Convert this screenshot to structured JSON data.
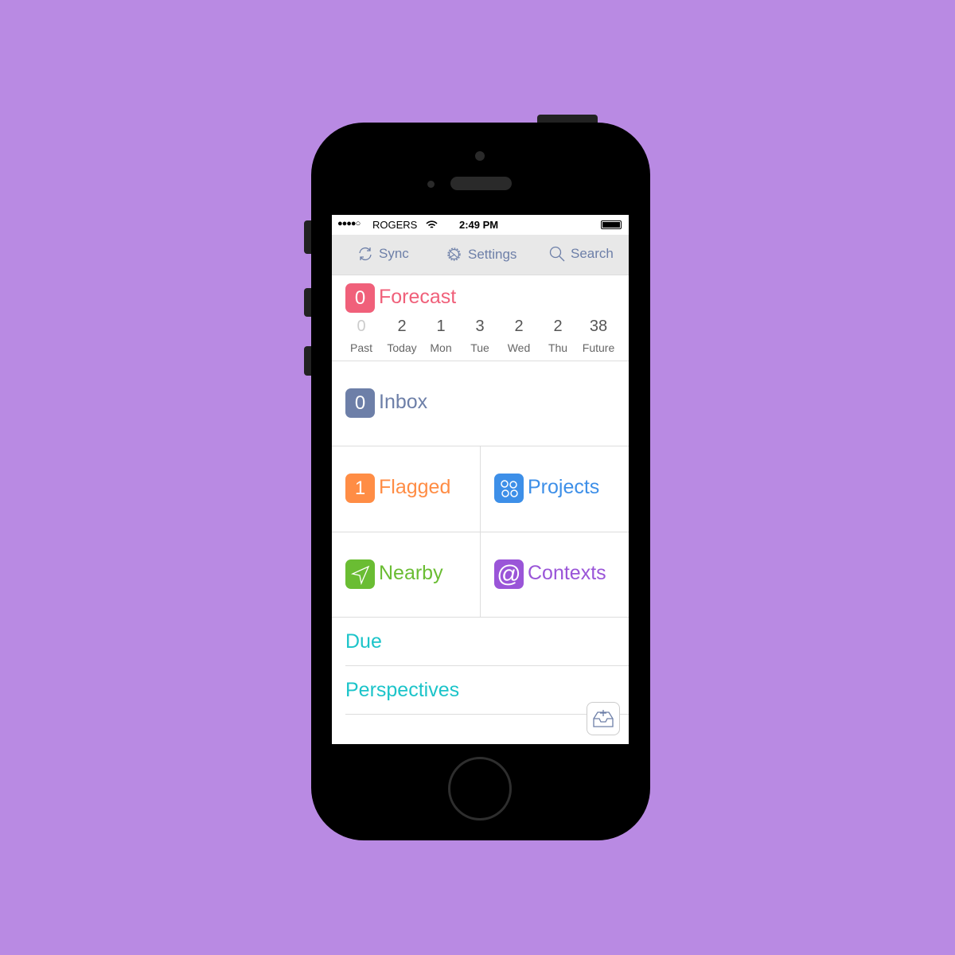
{
  "status_bar": {
    "carrier": "ROGERS",
    "signal": "●●●●○",
    "time": "2:49 PM",
    "icons": [
      "wifi-icon",
      "battery-icon"
    ]
  },
  "toolbar": {
    "sync": "Sync",
    "settings": "Settings",
    "search": "Search"
  },
  "forecast": {
    "count": "0",
    "label": "Forecast",
    "color": "#f0607a",
    "days": [
      {
        "n": "0",
        "l": "Past"
      },
      {
        "n": "2",
        "l": "Today"
      },
      {
        "n": "1",
        "l": "Mon"
      },
      {
        "n": "3",
        "l": "Tue"
      },
      {
        "n": "2",
        "l": "Wed"
      },
      {
        "n": "2",
        "l": "Thu"
      },
      {
        "n": "38",
        "l": "Future"
      }
    ]
  },
  "inbox": {
    "count": "0",
    "label": "Inbox",
    "color": "#6d7fa8"
  },
  "flagged": {
    "count": "1",
    "label": "Flagged",
    "color": "#ff8d45"
  },
  "projects": {
    "label": "Projects",
    "color": "#3d8fe8"
  },
  "nearby": {
    "label": "Nearby",
    "color": "#6abd33"
  },
  "contexts": {
    "label": "Contexts",
    "color": "#9a55d8"
  },
  "due": {
    "label": "Due"
  },
  "perspectives": {
    "label": "Perspectives"
  }
}
